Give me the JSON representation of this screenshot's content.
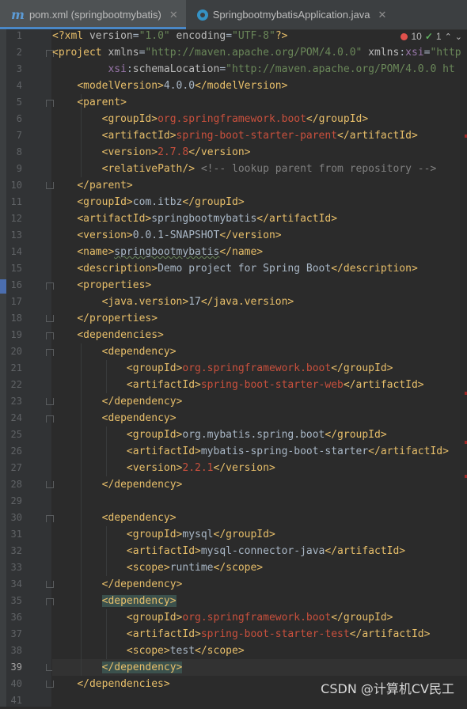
{
  "tabs": [
    {
      "label": "pom.xml (springbootmybatis)",
      "icon": "maven-icon",
      "active": true
    },
    {
      "label": "SpringbootmybatisApplication.java",
      "icon": "java-class-icon",
      "active": false
    }
  ],
  "inspections": {
    "errors": "10",
    "warnings": "1"
  },
  "line_numbers": [
    "1",
    "2",
    "3",
    "4",
    "5",
    "6",
    "7",
    "8",
    "9",
    "10",
    "11",
    "12",
    "13",
    "14",
    "15",
    "16",
    "17",
    "18",
    "19",
    "20",
    "21",
    "22",
    "23",
    "24",
    "25",
    "26",
    "27",
    "28",
    "29",
    "30",
    "31",
    "32",
    "33",
    "34",
    "35",
    "36",
    "37",
    "38",
    "39",
    "40",
    "41"
  ],
  "current_line": 39,
  "code": [
    [
      [
        "decl",
        "<?xml "
      ],
      [
        "attr",
        "version"
      ],
      [
        "text",
        "="
      ],
      [
        "val",
        "\"1.0\""
      ],
      [
        "attr",
        " encoding"
      ],
      [
        "text",
        "="
      ],
      [
        "val",
        "\"UTF-8\""
      ],
      [
        "decl",
        "?>"
      ]
    ],
    [
      [
        "tag",
        "<project "
      ],
      [
        "attr",
        "xmlns"
      ],
      [
        "text",
        "="
      ],
      [
        "val",
        "\"http://maven.apache.org/POM/4.0.0\""
      ],
      [
        "attr",
        " xmlns"
      ],
      [
        "text",
        ":"
      ],
      [
        "ns",
        "xsi"
      ],
      [
        "text",
        "="
      ],
      [
        "val",
        "\"http"
      ]
    ],
    [
      [
        "text",
        "         "
      ],
      [
        "ns",
        "xsi"
      ],
      [
        "text",
        ":"
      ],
      [
        "attr",
        "schemaLocation"
      ],
      [
        "text",
        "="
      ],
      [
        "val",
        "\"http://maven.apache.org/POM/4.0.0 ht"
      ]
    ],
    [
      [
        "text",
        "    "
      ],
      [
        "tag",
        "<modelVersion>"
      ],
      [
        "text",
        "4.0.0"
      ],
      [
        "tag",
        "</modelVersion>"
      ]
    ],
    [
      [
        "text",
        "    "
      ],
      [
        "tag",
        "<parent>"
      ]
    ],
    [
      [
        "text",
        "        "
      ],
      [
        "tag",
        "<groupId>"
      ],
      [
        "pink",
        "org.springframework.boot"
      ],
      [
        "tag",
        "</groupId>"
      ]
    ],
    [
      [
        "text",
        "        "
      ],
      [
        "tag",
        "<artifactId>"
      ],
      [
        "pink",
        "spring-boot-starter-parent"
      ],
      [
        "tag",
        "</artifactId>"
      ]
    ],
    [
      [
        "text",
        "        "
      ],
      [
        "tag",
        "<version>"
      ],
      [
        "pink",
        "2.7.8"
      ],
      [
        "tag",
        "</version>"
      ]
    ],
    [
      [
        "text",
        "        "
      ],
      [
        "tag",
        "<relativePath/>"
      ],
      [
        "comment",
        " <!-- lookup parent from repository -->"
      ]
    ],
    [
      [
        "text",
        "    "
      ],
      [
        "tag",
        "</parent>"
      ]
    ],
    [
      [
        "text",
        "    "
      ],
      [
        "tag",
        "<groupId>"
      ],
      [
        "text",
        "com.itbz"
      ],
      [
        "tag",
        "</groupId>"
      ]
    ],
    [
      [
        "text",
        "    "
      ],
      [
        "tag",
        "<artifactId>"
      ],
      [
        "text",
        "springbootmybatis"
      ],
      [
        "tag",
        "</artifactId>"
      ]
    ],
    [
      [
        "text",
        "    "
      ],
      [
        "tag",
        "<version>"
      ],
      [
        "text",
        "0.0.1-SNAPSHOT"
      ],
      [
        "tag",
        "</version>"
      ]
    ],
    [
      [
        "text",
        "    "
      ],
      [
        "tag",
        "<name>"
      ],
      [
        "typo",
        "springbootmybatis"
      ],
      [
        "tag",
        "</name>"
      ]
    ],
    [
      [
        "text",
        "    "
      ],
      [
        "tag",
        "<description>"
      ],
      [
        "text",
        "Demo project for Spring Boot"
      ],
      [
        "tag",
        "</description>"
      ]
    ],
    [
      [
        "text",
        "    "
      ],
      [
        "tag",
        "<properties>"
      ]
    ],
    [
      [
        "text",
        "        "
      ],
      [
        "tag",
        "<java.version>"
      ],
      [
        "text",
        "17"
      ],
      [
        "tag",
        "</java.version>"
      ]
    ],
    [
      [
        "text",
        "    "
      ],
      [
        "tag",
        "</properties>"
      ]
    ],
    [
      [
        "text",
        "    "
      ],
      [
        "tag",
        "<dependencies>"
      ]
    ],
    [
      [
        "text",
        "        "
      ],
      [
        "tag",
        "<dependency>"
      ]
    ],
    [
      [
        "text",
        "            "
      ],
      [
        "tag",
        "<groupId>"
      ],
      [
        "pink",
        "org.springframework.boot"
      ],
      [
        "tag",
        "</groupId>"
      ]
    ],
    [
      [
        "text",
        "            "
      ],
      [
        "tag",
        "<artifactId>"
      ],
      [
        "pink",
        "spring-boot-starter-web"
      ],
      [
        "tag",
        "</artifactId>"
      ]
    ],
    [
      [
        "text",
        "        "
      ],
      [
        "tag",
        "</dependency>"
      ]
    ],
    [
      [
        "text",
        "        "
      ],
      [
        "tag",
        "<dependency>"
      ]
    ],
    [
      [
        "text",
        "            "
      ],
      [
        "tag",
        "<groupId>"
      ],
      [
        "text",
        "org.mybatis.spring.boot"
      ],
      [
        "tag",
        "</groupId>"
      ]
    ],
    [
      [
        "text",
        "            "
      ],
      [
        "tag",
        "<artifactId>"
      ],
      [
        "text",
        "mybatis-spring-boot-starter"
      ],
      [
        "tag",
        "</artifactId>"
      ]
    ],
    [
      [
        "text",
        "            "
      ],
      [
        "tag",
        "<version>"
      ],
      [
        "pink",
        "2.2.1"
      ],
      [
        "tag",
        "</version>"
      ]
    ],
    [
      [
        "text",
        "        "
      ],
      [
        "tag",
        "</dependency>"
      ]
    ],
    [
      [
        "text",
        ""
      ]
    ],
    [
      [
        "text",
        "        "
      ],
      [
        "tag",
        "<dependency>"
      ]
    ],
    [
      [
        "text",
        "            "
      ],
      [
        "tag",
        "<groupId>"
      ],
      [
        "text",
        "mysql"
      ],
      [
        "tag",
        "</groupId>"
      ]
    ],
    [
      [
        "text",
        "            "
      ],
      [
        "tag",
        "<artifactId>"
      ],
      [
        "text",
        "mysql-connector-java"
      ],
      [
        "tag",
        "</artifactId>"
      ]
    ],
    [
      [
        "text",
        "            "
      ],
      [
        "tag",
        "<scope>"
      ],
      [
        "text",
        "runtime"
      ],
      [
        "tag",
        "</scope>"
      ]
    ],
    [
      [
        "text",
        "        "
      ],
      [
        "tag",
        "</dependency>"
      ]
    ],
    [
      [
        "text",
        "        "
      ],
      [
        "hltag",
        "<dependency>"
      ]
    ],
    [
      [
        "text",
        "            "
      ],
      [
        "tag",
        "<groupId>"
      ],
      [
        "pink",
        "org.springframework.boot"
      ],
      [
        "tag",
        "</groupId>"
      ]
    ],
    [
      [
        "text",
        "            "
      ],
      [
        "tag",
        "<artifactId>"
      ],
      [
        "pink",
        "spring-boot-starter-test"
      ],
      [
        "tag",
        "</artifactId>"
      ]
    ],
    [
      [
        "text",
        "            "
      ],
      [
        "tag",
        "<scope>"
      ],
      [
        "text",
        "test"
      ],
      [
        "tag",
        "</scope>"
      ]
    ],
    [
      [
        "text",
        "        "
      ],
      [
        "hltag",
        "</dependency>"
      ]
    ],
    [
      [
        "text",
        "    "
      ],
      [
        "tag",
        "</dependencies>"
      ]
    ],
    [
      [
        "text",
        ""
      ]
    ]
  ],
  "watermark": "CSDN @计算机CV民工",
  "colors": {
    "background": "#2b2b2b",
    "tag": "#e8bf6a",
    "string": "#6a8759",
    "error_text": "#c9503d",
    "namespace": "#9876aa",
    "comment": "#808080",
    "accent": "#4a88c7"
  }
}
